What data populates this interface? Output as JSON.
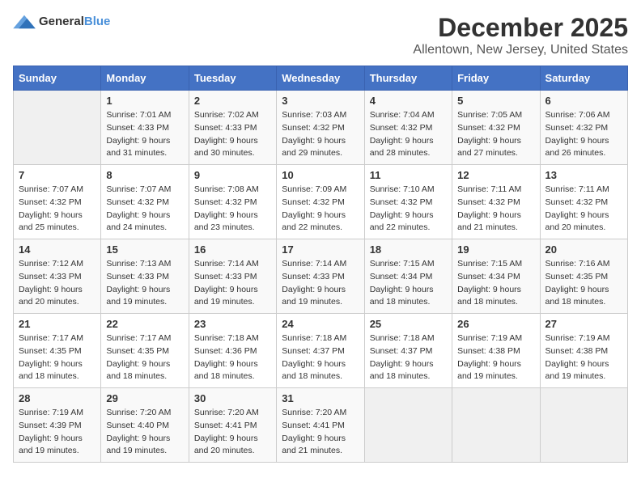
{
  "header": {
    "logo_general": "General",
    "logo_blue": "Blue",
    "month_year": "December 2025",
    "location": "Allentown, New Jersey, United States"
  },
  "days_of_week": [
    "Sunday",
    "Monday",
    "Tuesday",
    "Wednesday",
    "Thursday",
    "Friday",
    "Saturday"
  ],
  "weeks": [
    [
      {
        "day": "",
        "sunrise": "",
        "sunset": "",
        "daylight": ""
      },
      {
        "day": "1",
        "sunrise": "Sunrise: 7:01 AM",
        "sunset": "Sunset: 4:33 PM",
        "daylight": "Daylight: 9 hours and 31 minutes."
      },
      {
        "day": "2",
        "sunrise": "Sunrise: 7:02 AM",
        "sunset": "Sunset: 4:33 PM",
        "daylight": "Daylight: 9 hours and 30 minutes."
      },
      {
        "day": "3",
        "sunrise": "Sunrise: 7:03 AM",
        "sunset": "Sunset: 4:32 PM",
        "daylight": "Daylight: 9 hours and 29 minutes."
      },
      {
        "day": "4",
        "sunrise": "Sunrise: 7:04 AM",
        "sunset": "Sunset: 4:32 PM",
        "daylight": "Daylight: 9 hours and 28 minutes."
      },
      {
        "day": "5",
        "sunrise": "Sunrise: 7:05 AM",
        "sunset": "Sunset: 4:32 PM",
        "daylight": "Daylight: 9 hours and 27 minutes."
      },
      {
        "day": "6",
        "sunrise": "Sunrise: 7:06 AM",
        "sunset": "Sunset: 4:32 PM",
        "daylight": "Daylight: 9 hours and 26 minutes."
      }
    ],
    [
      {
        "day": "7",
        "sunrise": "Sunrise: 7:07 AM",
        "sunset": "Sunset: 4:32 PM",
        "daylight": "Daylight: 9 hours and 25 minutes."
      },
      {
        "day": "8",
        "sunrise": "Sunrise: 7:07 AM",
        "sunset": "Sunset: 4:32 PM",
        "daylight": "Daylight: 9 hours and 24 minutes."
      },
      {
        "day": "9",
        "sunrise": "Sunrise: 7:08 AM",
        "sunset": "Sunset: 4:32 PM",
        "daylight": "Daylight: 9 hours and 23 minutes."
      },
      {
        "day": "10",
        "sunrise": "Sunrise: 7:09 AM",
        "sunset": "Sunset: 4:32 PM",
        "daylight": "Daylight: 9 hours and 22 minutes."
      },
      {
        "day": "11",
        "sunrise": "Sunrise: 7:10 AM",
        "sunset": "Sunset: 4:32 PM",
        "daylight": "Daylight: 9 hours and 22 minutes."
      },
      {
        "day": "12",
        "sunrise": "Sunrise: 7:11 AM",
        "sunset": "Sunset: 4:32 PM",
        "daylight": "Daylight: 9 hours and 21 minutes."
      },
      {
        "day": "13",
        "sunrise": "Sunrise: 7:11 AM",
        "sunset": "Sunset: 4:32 PM",
        "daylight": "Daylight: 9 hours and 20 minutes."
      }
    ],
    [
      {
        "day": "14",
        "sunrise": "Sunrise: 7:12 AM",
        "sunset": "Sunset: 4:33 PM",
        "daylight": "Daylight: 9 hours and 20 minutes."
      },
      {
        "day": "15",
        "sunrise": "Sunrise: 7:13 AM",
        "sunset": "Sunset: 4:33 PM",
        "daylight": "Daylight: 9 hours and 19 minutes."
      },
      {
        "day": "16",
        "sunrise": "Sunrise: 7:14 AM",
        "sunset": "Sunset: 4:33 PM",
        "daylight": "Daylight: 9 hours and 19 minutes."
      },
      {
        "day": "17",
        "sunrise": "Sunrise: 7:14 AM",
        "sunset": "Sunset: 4:33 PM",
        "daylight": "Daylight: 9 hours and 19 minutes."
      },
      {
        "day": "18",
        "sunrise": "Sunrise: 7:15 AM",
        "sunset": "Sunset: 4:34 PM",
        "daylight": "Daylight: 9 hours and 18 minutes."
      },
      {
        "day": "19",
        "sunrise": "Sunrise: 7:15 AM",
        "sunset": "Sunset: 4:34 PM",
        "daylight": "Daylight: 9 hours and 18 minutes."
      },
      {
        "day": "20",
        "sunrise": "Sunrise: 7:16 AM",
        "sunset": "Sunset: 4:35 PM",
        "daylight": "Daylight: 9 hours and 18 minutes."
      }
    ],
    [
      {
        "day": "21",
        "sunrise": "Sunrise: 7:17 AM",
        "sunset": "Sunset: 4:35 PM",
        "daylight": "Daylight: 9 hours and 18 minutes."
      },
      {
        "day": "22",
        "sunrise": "Sunrise: 7:17 AM",
        "sunset": "Sunset: 4:35 PM",
        "daylight": "Daylight: 9 hours and 18 minutes."
      },
      {
        "day": "23",
        "sunrise": "Sunrise: 7:18 AM",
        "sunset": "Sunset: 4:36 PM",
        "daylight": "Daylight: 9 hours and 18 minutes."
      },
      {
        "day": "24",
        "sunrise": "Sunrise: 7:18 AM",
        "sunset": "Sunset: 4:37 PM",
        "daylight": "Daylight: 9 hours and 18 minutes."
      },
      {
        "day": "25",
        "sunrise": "Sunrise: 7:18 AM",
        "sunset": "Sunset: 4:37 PM",
        "daylight": "Daylight: 9 hours and 18 minutes."
      },
      {
        "day": "26",
        "sunrise": "Sunrise: 7:19 AM",
        "sunset": "Sunset: 4:38 PM",
        "daylight": "Daylight: 9 hours and 19 minutes."
      },
      {
        "day": "27",
        "sunrise": "Sunrise: 7:19 AM",
        "sunset": "Sunset: 4:38 PM",
        "daylight": "Daylight: 9 hours and 19 minutes."
      }
    ],
    [
      {
        "day": "28",
        "sunrise": "Sunrise: 7:19 AM",
        "sunset": "Sunset: 4:39 PM",
        "daylight": "Daylight: 9 hours and 19 minutes."
      },
      {
        "day": "29",
        "sunrise": "Sunrise: 7:20 AM",
        "sunset": "Sunset: 4:40 PM",
        "daylight": "Daylight: 9 hours and 19 minutes."
      },
      {
        "day": "30",
        "sunrise": "Sunrise: 7:20 AM",
        "sunset": "Sunset: 4:41 PM",
        "daylight": "Daylight: 9 hours and 20 minutes."
      },
      {
        "day": "31",
        "sunrise": "Sunrise: 7:20 AM",
        "sunset": "Sunset: 4:41 PM",
        "daylight": "Daylight: 9 hours and 21 minutes."
      },
      {
        "day": "",
        "sunrise": "",
        "sunset": "",
        "daylight": ""
      },
      {
        "day": "",
        "sunrise": "",
        "sunset": "",
        "daylight": ""
      },
      {
        "day": "",
        "sunrise": "",
        "sunset": "",
        "daylight": ""
      }
    ]
  ]
}
